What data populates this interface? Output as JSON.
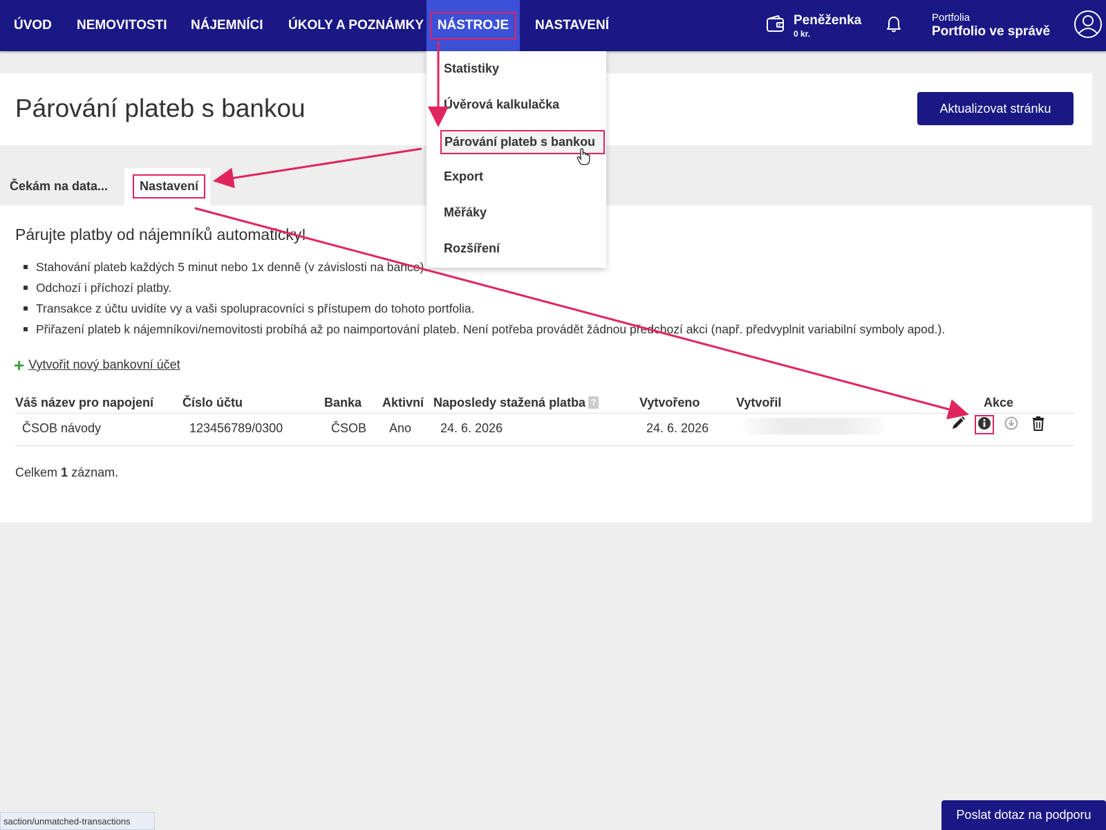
{
  "nav": {
    "items": [
      "ÚVOD",
      "NEMOVITOSTI",
      "NÁJEMNÍCI",
      "ÚKOLY A POZNÁMKY",
      "NÁSTROJE",
      "NASTAVENÍ"
    ],
    "active_index": 4,
    "wallet_label": "Peněženka",
    "wallet_amount": "0 kr.",
    "portfolio_label": "Portfolia",
    "portfolio_name": "Portfolio ve správě",
    "icons": {
      "wallet": "wallet-icon",
      "notifications": "bell-icon",
      "user": "user-avatar-icon"
    }
  },
  "dropdown": {
    "items": [
      "Statistiky",
      "Úvěrová kalkulačka",
      "Párování plateb s bankou",
      "Export",
      "Měřáky",
      "Rozšíření"
    ],
    "highlighted_index": 2
  },
  "header": {
    "title": "Párování plateb s bankou",
    "refresh_button": "Aktualizovat stránku"
  },
  "tabs": [
    "Čekám na data...",
    "Nastavení"
  ],
  "content": {
    "heading": "Párujte platby od nájemníků automaticky!",
    "features": [
      "Stahování plateb každých 5 minut nebo 1x denně (v závislosti na bance).",
      "Odchozí i příchozí platby.",
      "Transakce z účtu uvidíte vy a vaši spolupracovníci s přístupem do tohoto portfolia.",
      "Přiřazení plateb k nájemníkovi/nemovitosti probíhá až po naimportování plateb. Není potřeba provádět žádnou předchozí akci (např. předvyplnit variabilní symboly apod.)."
    ],
    "create_link": "Vytvořit nový bankovní účet",
    "table": {
      "headers": [
        "Váš název pro napojení",
        "Číslo účtu",
        "Banka",
        "Aktivní",
        "Naposledy stažená platba",
        "Vytvořeno",
        "Vytvořil",
        "Akce"
      ],
      "help_mark": "?",
      "rows": [
        {
          "name": "ČSOB návody",
          "account": "123456789/0300",
          "bank": "ČSOB",
          "active": "Ano",
          "last_payment": "24. 6. 2026",
          "created": "24. 6. 2026",
          "created_by": "",
          "actions": [
            "edit-icon",
            "info-icon",
            "download-icon",
            "trash-icon"
          ]
        }
      ]
    },
    "total_prefix": "Celkem",
    "total_count": "1",
    "total_suffix": "záznam."
  },
  "status_url": "saction/unmatched-transactions",
  "support_button": "Poslat dotaz na podporu",
  "colors": {
    "nav_bg": "#1a1885",
    "nav_active": "#3c50d8",
    "annotation": "#e0245e",
    "plus": "#3aa33a",
    "page_bg": "#eeeeee"
  }
}
